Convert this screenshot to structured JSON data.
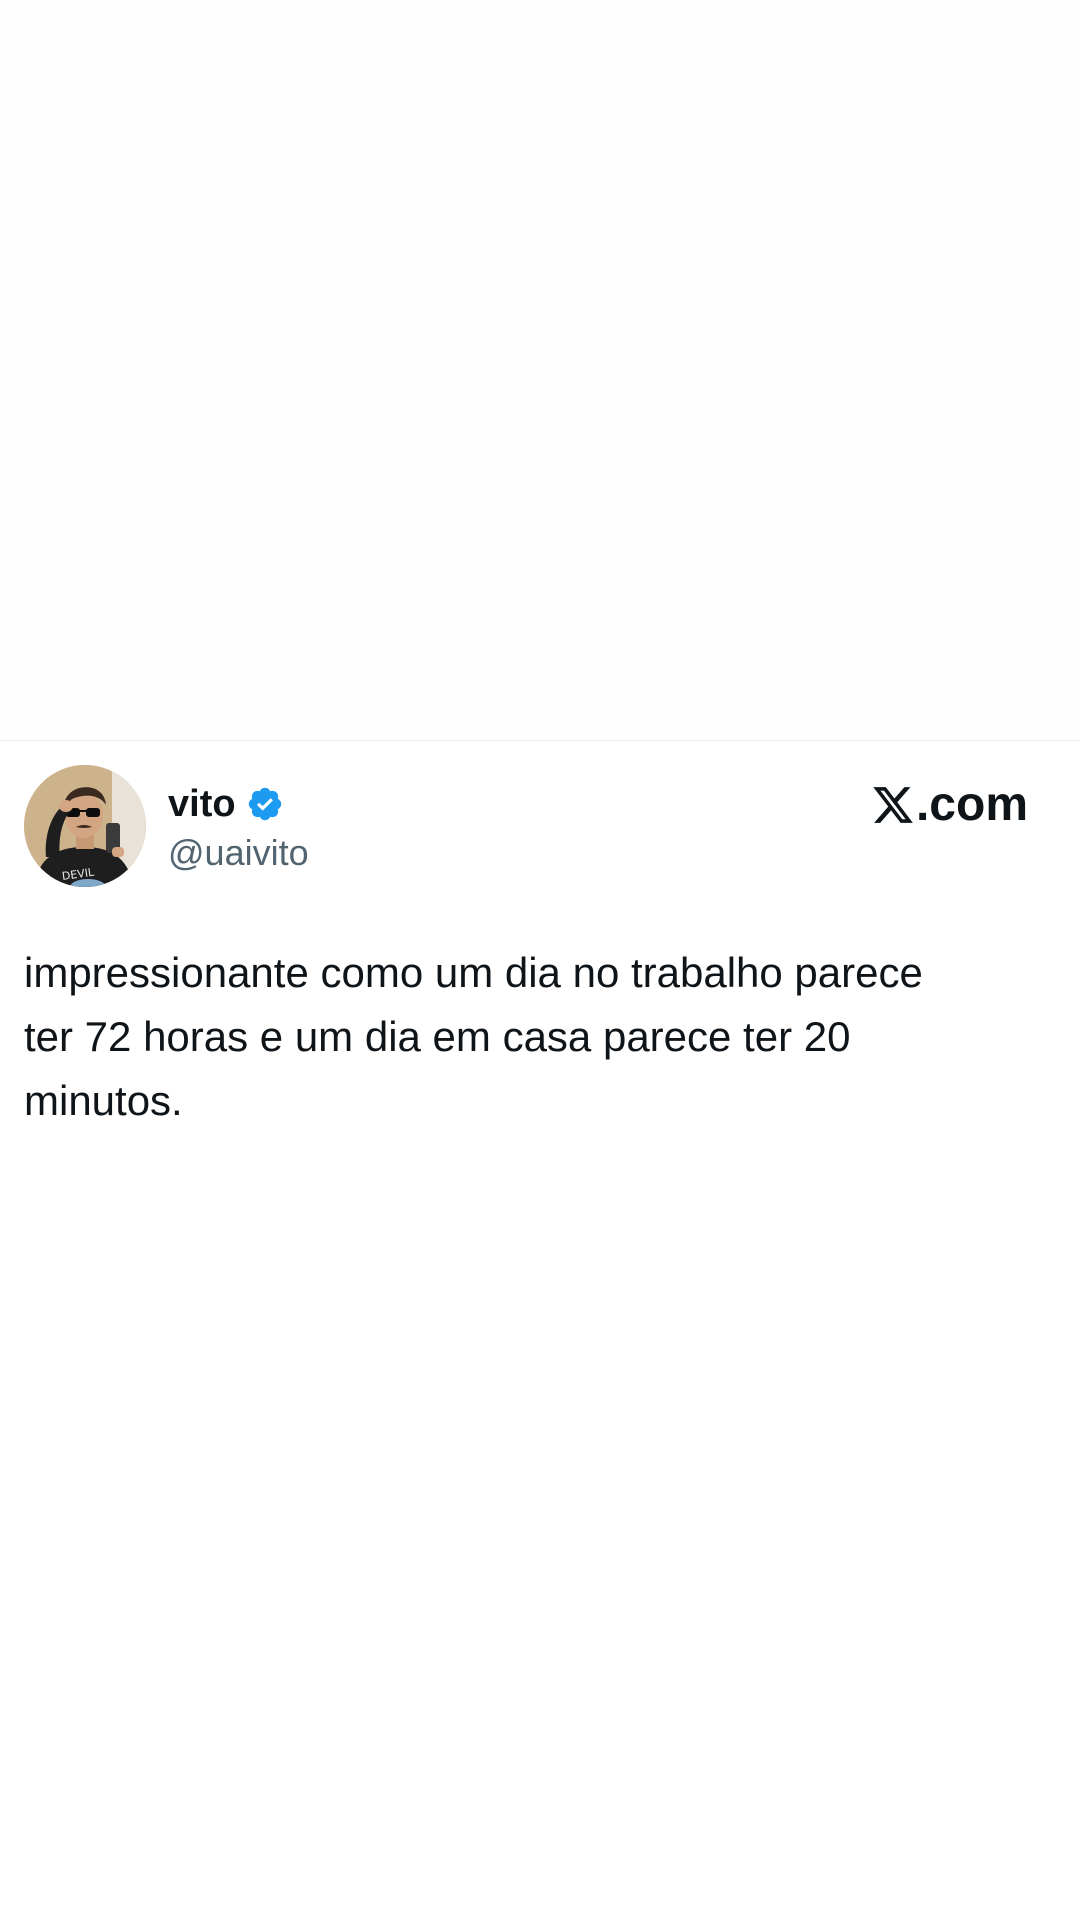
{
  "tweet": {
    "author": {
      "display_name": "vito",
      "handle": "@uaivito",
      "verified": true,
      "avatar_icon": "profile-photo"
    },
    "brand": {
      "text": ".com",
      "logo": "x-logo-icon"
    },
    "text": "impressionante como um dia no trabalho parece\nter 72 horas e um dia em casa parece ter 20\nminutos."
  },
  "colors": {
    "verified": "#1d9bf0",
    "handle": "#536471",
    "text": "#0f1419"
  }
}
